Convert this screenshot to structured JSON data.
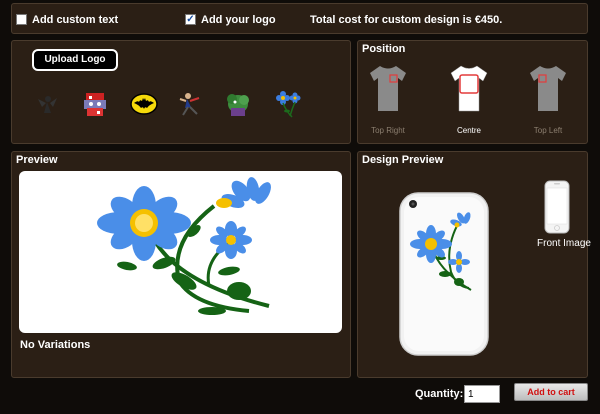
{
  "top_bar": {
    "custom_text_label": "Add custom text",
    "custom_text_checked": false,
    "logo_label": "Add your logo",
    "logo_checked": true,
    "total_cost": "Total cost for custom design is €450."
  },
  "logos": {
    "upload_label": "Upload Logo",
    "items": [
      "tinkerbell-icon",
      "pokemon-icon",
      "batman-logo-icon",
      "fighter-icon",
      "hulk-icon",
      "flower-icon"
    ]
  },
  "position": {
    "title": "Position",
    "options": [
      {
        "label": "Top Right",
        "selected": false
      },
      {
        "label": "Centre",
        "selected": true
      },
      {
        "label": "Top Left",
        "selected": false
      }
    ]
  },
  "preview": {
    "title": "Preview",
    "variations": "No Variations"
  },
  "design_preview": {
    "title": "Design Preview",
    "front_label": "Front Image"
  },
  "order": {
    "quantity_label": "Quantity:",
    "quantity_value": "1",
    "cart_label": "Add to cart"
  },
  "colors": {
    "panel": "#2b1f15",
    "background": "#0f0c09",
    "cart_text": "#d01010",
    "selected_border": "#e33b3b"
  }
}
